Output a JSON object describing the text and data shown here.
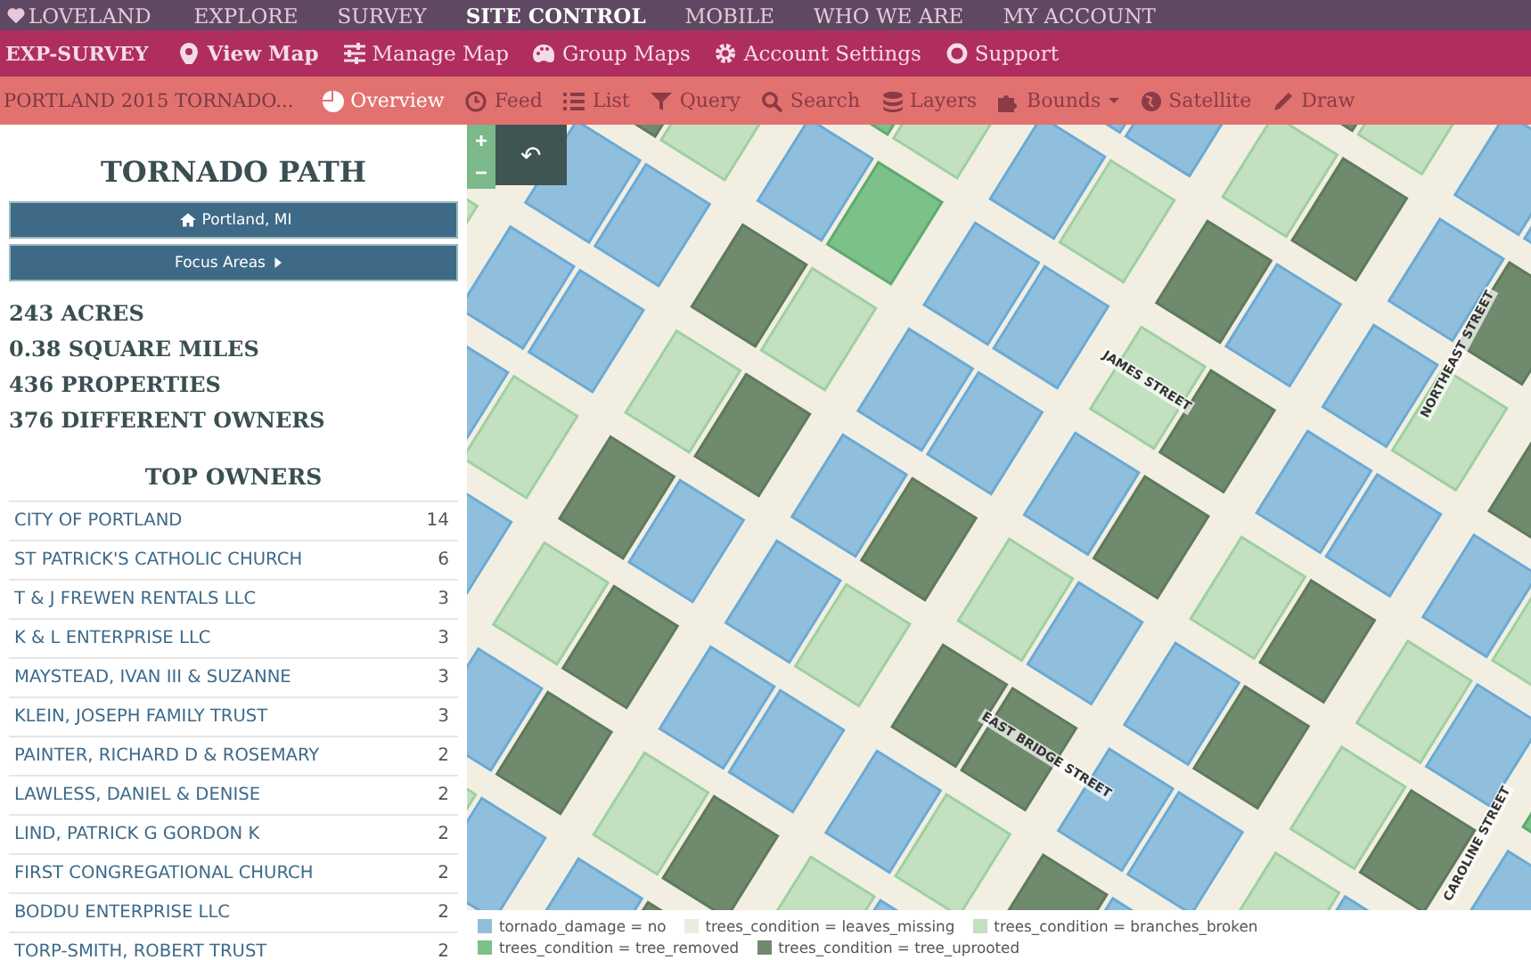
{
  "top_nav": {
    "brand": "LOVELAND",
    "items": [
      {
        "label": "EXPLORE",
        "selected": false
      },
      {
        "label": "SURVEY",
        "selected": false
      },
      {
        "label": "SITE CONTROL",
        "selected": true
      },
      {
        "label": "MOBILE",
        "selected": false
      },
      {
        "label": "WHO WE ARE",
        "selected": false
      },
      {
        "label": "MY ACCOUNT",
        "selected": false
      }
    ]
  },
  "app_bar": {
    "title": "EXP-SURVEY",
    "items": [
      {
        "label": "View Map",
        "selected": true
      },
      {
        "label": "Manage Map",
        "selected": false
      },
      {
        "label": "Group Maps",
        "selected": false
      },
      {
        "label": "Account Settings",
        "selected": false
      },
      {
        "label": "Support",
        "selected": false
      }
    ]
  },
  "map_bar": {
    "title": "PORTLAND 2015 TORNADO...",
    "items": [
      {
        "label": "Overview",
        "selected": true
      },
      {
        "label": "Feed",
        "selected": false
      },
      {
        "label": "List",
        "selected": false
      },
      {
        "label": "Query",
        "selected": false
      },
      {
        "label": "Search",
        "selected": false
      },
      {
        "label": "Layers",
        "selected": false
      },
      {
        "label": "Bounds",
        "selected": false,
        "dropdown": true
      },
      {
        "label": "Satellite",
        "selected": false
      },
      {
        "label": "Draw",
        "selected": false
      }
    ]
  },
  "sidebar": {
    "title": "TORNADO PATH",
    "buttons": [
      {
        "label": "Portland, MI"
      },
      {
        "label": "Focus Areas"
      }
    ],
    "stats": [
      "243 ACRES",
      "0.38 SQUARE MILES",
      "436 PROPERTIES",
      "376 DIFFERENT OWNERS"
    ],
    "owners_title": "TOP OWNERS",
    "owners": [
      {
        "name": "CITY OF PORTLAND",
        "count": "14"
      },
      {
        "name": "ST PATRICK'S CATHOLIC CHURCH",
        "count": "6"
      },
      {
        "name": "T & J FREWEN RENTALS LLC",
        "count": "3"
      },
      {
        "name": "K & L ENTERPRISE LLC",
        "count": "3"
      },
      {
        "name": "MAYSTEAD, IVAN III & SUZANNE",
        "count": "3"
      },
      {
        "name": "KLEIN, JOSEPH FAMILY TRUST",
        "count": "3"
      },
      {
        "name": "PAINTER, RICHARD D & ROSEMARY",
        "count": "2"
      },
      {
        "name": "LAWLESS, DANIEL & DENISE",
        "count": "2"
      },
      {
        "name": "LIND, PATRICK G GORDON K",
        "count": "2"
      },
      {
        "name": "FIRST CONGREGATIONAL CHURCH",
        "count": "2"
      },
      {
        "name": "BODDU ENTERPRISE LLC",
        "count": "2"
      },
      {
        "name": "TORP-SMITH, ROBERT TRUST",
        "count": "2"
      }
    ]
  },
  "map": {
    "zoom_in": "+",
    "zoom_out": "−",
    "back": "↶",
    "street_labels": [
      "JAMES STREET",
      "NORTHEAST STREET",
      "EAST BRIDGE STREET",
      "CAROLINE STREET"
    ],
    "legend": [
      {
        "label": "tornado_damage = no",
        "color": "#8fbfdc"
      },
      {
        "label": "trees_condition = leaves_missing",
        "color": "#e8eedf"
      },
      {
        "label": "trees_condition = branches_broken",
        "color": "#c3e0c0"
      },
      {
        "label": "trees_condition = tree_removed",
        "color": "#7cc08a"
      },
      {
        "label": "trees_condition = tree_uprooted",
        "color": "#6f8a6c"
      }
    ]
  }
}
